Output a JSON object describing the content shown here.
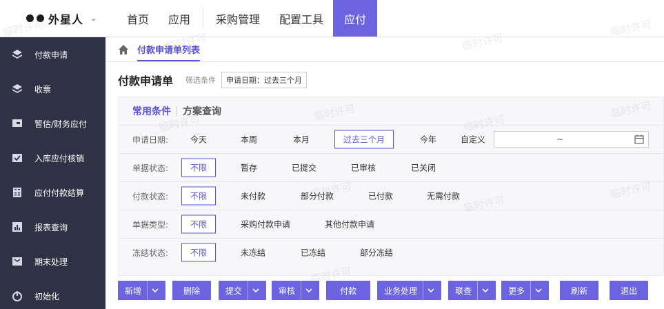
{
  "brand": {
    "name": "外星人"
  },
  "topnav": {
    "items": [
      {
        "label": "首页"
      },
      {
        "label": "应用"
      },
      {
        "label": "采购管理"
      },
      {
        "label": "配置工具"
      },
      {
        "label": "应付"
      }
    ],
    "active_index": 4
  },
  "sidebar": {
    "items": [
      {
        "label": "付款申请",
        "icon": "layers-icon"
      },
      {
        "label": "收票",
        "icon": "layers-icon"
      },
      {
        "label": "暂估/财务应付",
        "icon": "screen-icon"
      },
      {
        "label": "入库应付核销",
        "icon": "check-doc-icon"
      },
      {
        "label": "应付付款结算",
        "icon": "calculator-icon"
      },
      {
        "label": "报表查询",
        "icon": "report-icon"
      },
      {
        "label": "期末处理",
        "icon": "inbox-icon"
      },
      {
        "label": "初始化",
        "icon": "power-icon"
      }
    ]
  },
  "breadcrumb": {
    "tab": "付款申请单列表"
  },
  "main": {
    "title": "付款申请单",
    "filter_label": "筛选条件",
    "filter_tag": "申请日期：过去三个月"
  },
  "panel": {
    "tabs": [
      "常用条件",
      "方案查询"
    ],
    "rows": [
      {
        "label": "申请日期:",
        "options": [
          "今天",
          "本周",
          "本月",
          "过去三个月",
          "今年",
          "自定义"
        ],
        "selected": "过去三个月"
      },
      {
        "label": "单据状态:",
        "options": [
          "不限",
          "暂存",
          "已提交",
          "已审核",
          "已关闭"
        ],
        "selected": "不限"
      },
      {
        "label": "付款状态:",
        "options": [
          "不限",
          "未付款",
          "部分付款",
          "已付款",
          "无需付款"
        ],
        "selected": "不限"
      },
      {
        "label": "单据类型:",
        "options": [
          "不限",
          "采购付款申请",
          "其他付款申请"
        ],
        "selected": "不限"
      },
      {
        "label": "冻结状态:",
        "options": [
          "不限",
          "未冻结",
          "已冻结",
          "部分冻结"
        ],
        "selected": "不限"
      }
    ],
    "daterange_sep": "~"
  },
  "toolbar": {
    "buttons": [
      {
        "label": "新增",
        "dropdown": true
      },
      {
        "label": "删除",
        "dropdown": false
      },
      {
        "label": "提交",
        "dropdown": true
      },
      {
        "label": "审核",
        "dropdown": true
      },
      {
        "label": "付款",
        "dropdown": false
      },
      {
        "label": "业务处理",
        "dropdown": true
      },
      {
        "label": "联查",
        "dropdown": true
      },
      {
        "label": "更多",
        "dropdown": true
      },
      {
        "label": "刷新",
        "dropdown": false
      },
      {
        "label": "退出",
        "dropdown": false
      }
    ]
  },
  "watermark": "临时许可",
  "colors": {
    "accent": "#6b63e0",
    "sidebar": "#2f3145"
  }
}
